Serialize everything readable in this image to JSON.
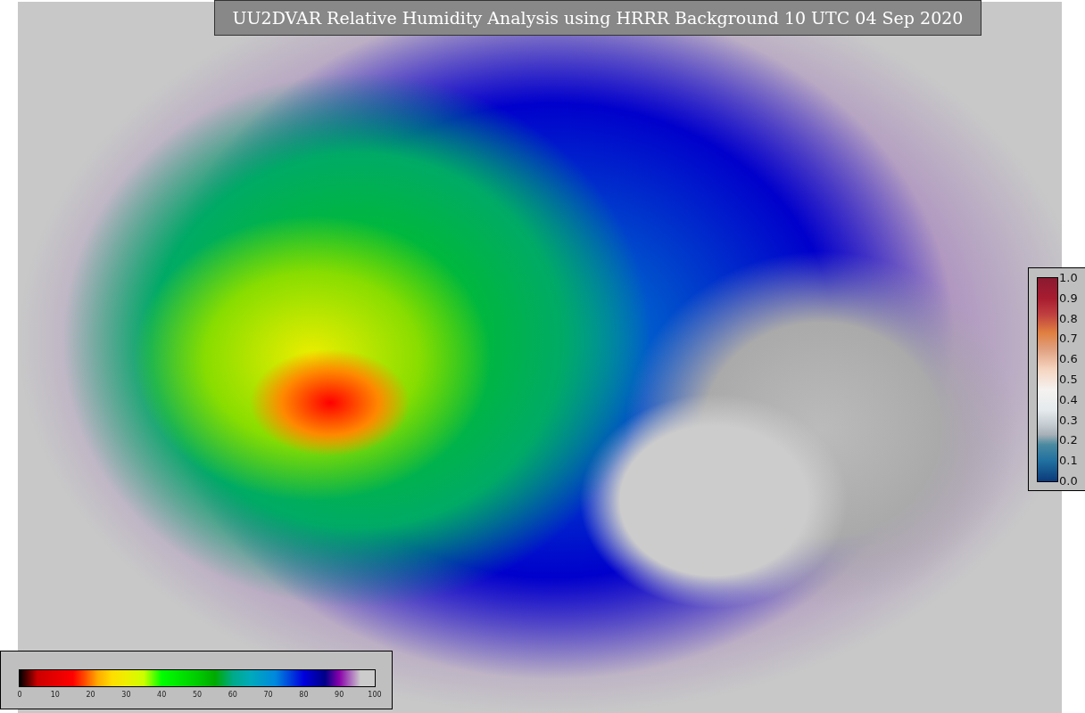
{
  "title": "UU2DVAR Relative Humidity Analysis using HRRR Background 10 UTC 04 Sep 2020",
  "humidity_colorbar": {
    "ticks": [
      "0",
      "10",
      "20",
      "30",
      "40",
      "50",
      "60",
      "70",
      "80",
      "90",
      "100"
    ]
  },
  "observation_colorbar": {
    "ticks": [
      "1.0",
      "0.9",
      "0.8",
      "0.7",
      "0.6",
      "0.5",
      "0.4",
      "0.3",
      "0.2",
      "0.1",
      "0.0"
    ]
  }
}
